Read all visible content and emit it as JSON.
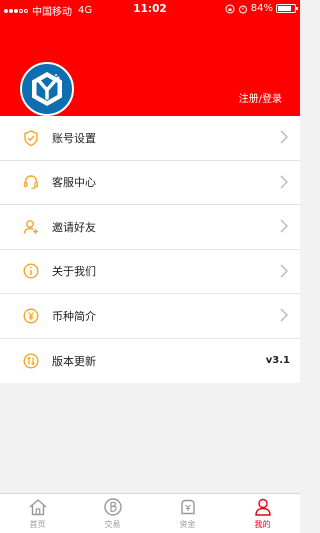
{
  "status_bar": {
    "carrier": "中国移动",
    "network": "4G",
    "time": "11:02",
    "battery_percent": "84%",
    "battery_level": 0.84
  },
  "header": {
    "background_color": "#ff0000",
    "avatar_icon": "app-logo-icon",
    "login_link": "注册/登录"
  },
  "menu": {
    "items": [
      {
        "label": "账号设置",
        "icon": "shield-check-icon"
      },
      {
        "label": "客服中心",
        "icon": "headset-icon"
      },
      {
        "label": "邀请好友",
        "icon": "add-user-icon"
      },
      {
        "label": "关于我们",
        "icon": "info-icon"
      },
      {
        "label": "币种简介",
        "icon": "yen-coin-icon"
      },
      {
        "label": "版本更新",
        "icon": "update-icon",
        "value": "v3.1"
      }
    ],
    "icon_color": "#f5a623"
  },
  "tabbar": {
    "items": [
      {
        "label": "首页",
        "icon": "home-icon"
      },
      {
        "label": "交易",
        "icon": "bitcoin-icon"
      },
      {
        "label": "资金",
        "icon": "wallet-icon"
      },
      {
        "label": "我的",
        "icon": "user-icon",
        "active": true
      }
    ],
    "active_color": "#e60012",
    "inactive_color": "#999999"
  }
}
